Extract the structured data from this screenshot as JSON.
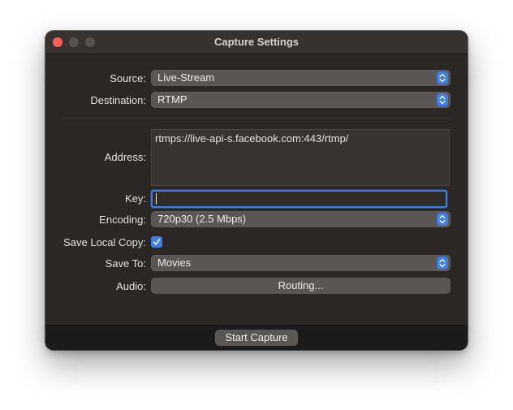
{
  "window": {
    "title": "Capture Settings"
  },
  "form": {
    "source": {
      "label": "Source:",
      "value": "Live-Stream"
    },
    "destination": {
      "label": "Destination:",
      "value": "RTMP"
    },
    "address": {
      "label": "Address:",
      "value": "rtmps://live-api-s.facebook.com:443/rtmp/"
    },
    "key": {
      "label": "Key:",
      "value": ""
    },
    "encoding": {
      "label": "Encoding:",
      "value": "720p30 (2.5 Mbps)"
    },
    "save_local_copy": {
      "label": "Save Local Copy:",
      "checked": true
    },
    "save_to": {
      "label": "Save To:",
      "value": "Movies"
    },
    "audio": {
      "label": "Audio:",
      "button": "Routing..."
    }
  },
  "footer": {
    "start_button": "Start Capture"
  },
  "colors": {
    "accent": "#3d7de8",
    "close": "#ff5f57",
    "window_bg": "#2b2725"
  },
  "icons": {
    "popup": "up-down-chevron-icon",
    "checkbox": "checkmark-icon"
  }
}
